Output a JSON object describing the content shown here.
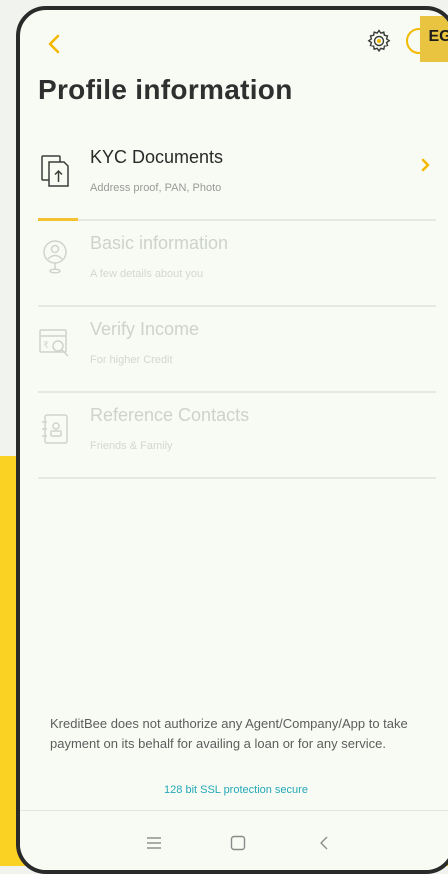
{
  "header": {
    "badge_text": "EG"
  },
  "page": {
    "title": "Profile information"
  },
  "items": [
    {
      "label": "KYC Documents",
      "sub": "Address proof, PAN, Photo",
      "icon": "document-upload-icon",
      "active": true
    },
    {
      "label": "Basic information",
      "sub": "A few details about you",
      "icon": "user-location-icon",
      "active": false
    },
    {
      "label": "Verify Income",
      "sub": "For higher Credit",
      "icon": "income-search-icon",
      "active": false
    },
    {
      "label": "Reference Contacts",
      "sub": "Friends & Family",
      "icon": "contacts-book-icon",
      "active": false
    }
  ],
  "kyc_progress_fraction": 0.1,
  "footer": {
    "disclaimer": "KreditBee does not authorize any Agent/Company/App to take payment on its behalf for availing a loan or for any service.",
    "ssl": "128 bit SSL protection secure"
  },
  "colors": {
    "accent": "#f2b900",
    "ssl_text": "#25a8b8",
    "background_yellow": "#f9d224"
  }
}
